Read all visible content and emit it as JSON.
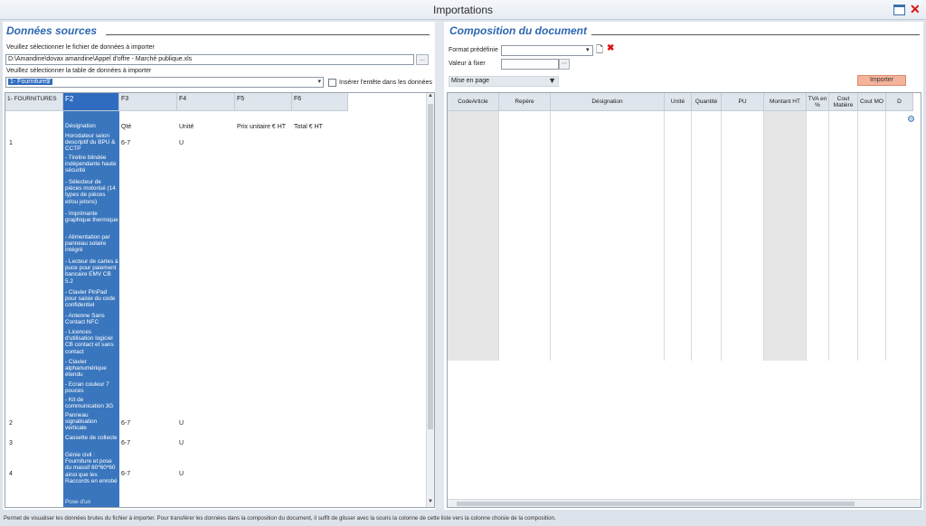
{
  "window": {
    "title": "Importations"
  },
  "left": {
    "title": "Données sources",
    "file_label": "Veuillez sélectionner le fichier de données à importer",
    "file_path": "D:\\Amandine\\dovax amandine\\Appel d'offre - Marché publique.xls",
    "browse_label": "...",
    "table_label": "Veuillez sélectionner la table de données à importer",
    "table_value": "1- Fourniture$'",
    "header_checkbox_label": "Insérer l'entête dans les données",
    "columns": [
      "1- FOURNITURES",
      "F2",
      "F3",
      "F4",
      "F5",
      "F6"
    ],
    "header_row": [
      "",
      "Désignation",
      "Qté",
      "Unité",
      "Prix unitaire € HT",
      "Total € HT"
    ],
    "rows": [
      {
        "num": "1",
        "designation": "Horodateur selon descriptif du BPU & CCTP",
        "qte": "6-7",
        "unite": "U"
      },
      {
        "num": "2",
        "designation": "Panneau signalisation verticale",
        "qte": "6-7",
        "unite": "U"
      },
      {
        "num": "3",
        "designation": "Cassette de collecte",
        "qte": "6-7",
        "unite": "U"
      },
      {
        "num": "4",
        "designation": "Génie civil : Fourniture et pose du massif 60*60*60 ainsi que les Raccords en enrobé",
        "qte": "6-7",
        "unite": "U"
      }
    ],
    "sub_items": [
      "- Tirelire blindée indépendante haute sécurité",
      "- Sélecteur de pièces motorisé (14 types de pièces et/ou jetons)",
      "- Imprimante graphique thermique",
      "- Alimentation par panneau solaire intégré",
      "- Lecteur de cartes à puce pour paiement bancaire EMV CB 5.2",
      "- Clavier PinPad pour saisie du code confidentiel",
      "- Antenne Sans Contact NFC",
      "- Licences d'utilisation logiciel CB contact et sans contact",
      "- Clavier alphanumérique étendu",
      "- Ecran couleur 7 pouces",
      "- Kit de communication 3G"
    ],
    "last_row": "Pose d'un"
  },
  "right": {
    "title": "Composition du document",
    "format_label": "Format prédéfinie",
    "format_value": "",
    "fix_label": "Valeur à fixer",
    "fix_value": "",
    "layout_label": "Mise en page",
    "import_label": "Importer",
    "columns": [
      "CodeArticle",
      "Repère",
      "Désignation",
      "Unité",
      "Quantité",
      "PU",
      "Montant HT",
      "TVA en %",
      "Cout Matière",
      "Cout MO",
      "D"
    ]
  },
  "status": "Permet de visualiser les données brutes du fichier à importer. Pour transférer les données dans la composition du document, il suffit de glisser avec la souris la colonne de cette liste vers la colonne choisie de la composition.",
  "colors": {
    "accent": "#2e67b1",
    "selection": "#2f6cc0",
    "import_button": "#f4b39a"
  }
}
